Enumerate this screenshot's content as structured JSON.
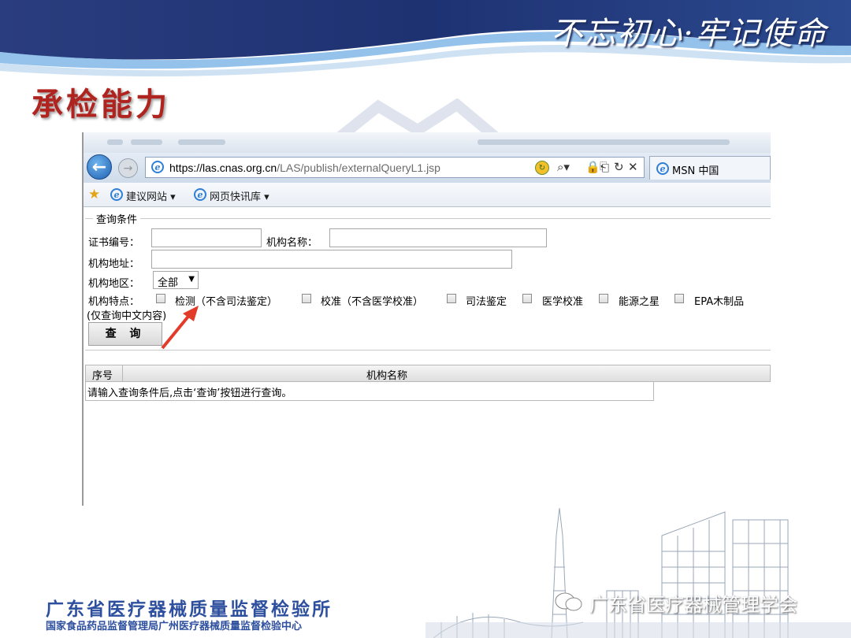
{
  "slide": {
    "slogan": "不忘初心·牢记使命",
    "title": "承检能力"
  },
  "browser": {
    "url_host": "https://las.cnas.org.cn",
    "url_path": "/LAS/publish/externalQueryL1.jsp",
    "tab_label": "MSN 中国",
    "favorites": [
      {
        "label": "建议网站 ▾"
      },
      {
        "label": "网页快讯库 ▾"
      }
    ]
  },
  "form": {
    "legend": "查询条件",
    "cert_no_label": "证书编号：",
    "org_name_label": "机构名称：",
    "org_address_label": "机构地址：",
    "region_label": "机构地区：",
    "region_value": "全部",
    "features_label": "机构特点：",
    "features": [
      "检测（不含司法鉴定）",
      "校准（不含医学校准）",
      "司法鉴定",
      "医学校准",
      "能源之星",
      "EPA木制品"
    ],
    "note": "(仅查询中文内容)",
    "query_button": "查 询"
  },
  "results": {
    "columns": [
      "序号",
      "机构名称"
    ],
    "empty_message": "请输入查询条件后,点击‘查询’按钮进行查询。"
  },
  "footer": {
    "org_name": "广东省医疗器械质量监督检验所",
    "org_sub": "国家食品药品监督管理局广州医疗器械质量监督检验中心",
    "wechat_label": "广东省医疗器械管理学会"
  },
  "colors": {
    "title": "#b0241f",
    "footer_text": "#2d4f9e",
    "banner_dark": "#1d2f6b"
  }
}
